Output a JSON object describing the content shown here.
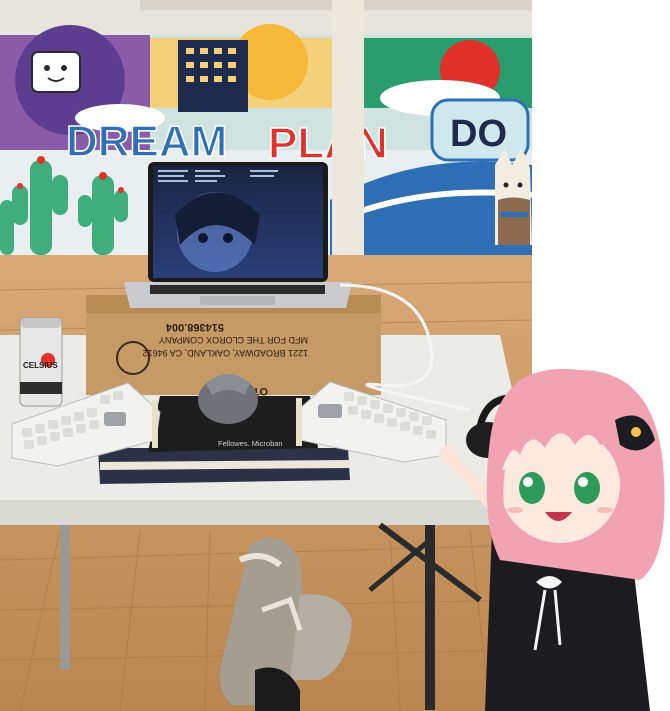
{
  "mural": {
    "word_dream": "DREAM",
    "word_plan": "PLAN",
    "word_do": "DO"
  },
  "box": {
    "code": "514368.004",
    "address_line1": "MFD FOR THE CLOROX COMPANY",
    "address_line2": "1221 BROADWAY, OAKLAND, CA 94612",
    "flap_text": "OTHE"
  },
  "can": {
    "brand": "CELSIUS"
  },
  "mousepad": {
    "brand": "Fellowes. Microban"
  },
  "colors": {
    "mural_blue": "#2f6fb5",
    "mural_red": "#e0322a",
    "hair_pink": "#f2a3b3",
    "floor_wood": "#c9955e",
    "table_white": "#e9e9e6"
  }
}
